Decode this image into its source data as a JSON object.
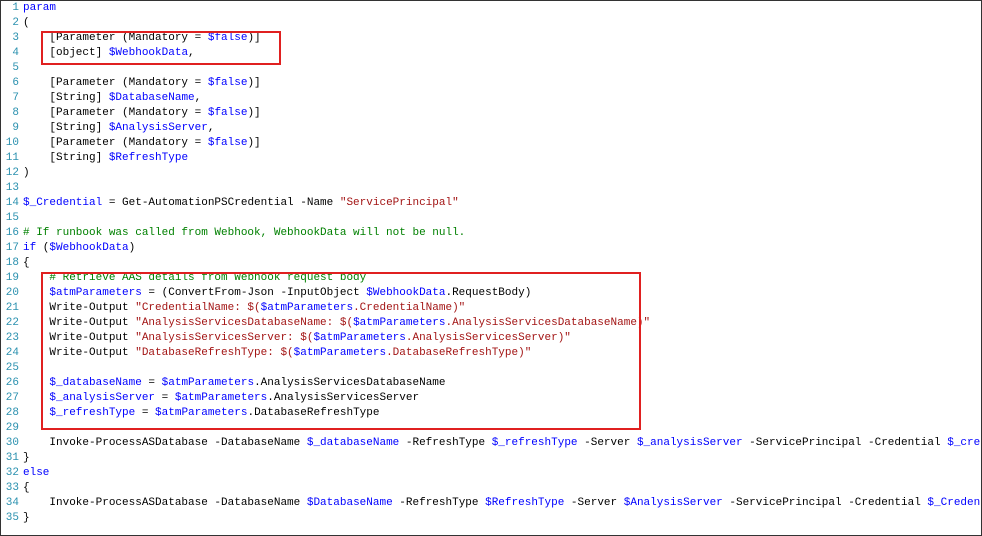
{
  "lines": [
    {
      "n": 1,
      "segs": [
        [
          "kw",
          "param"
        ]
      ]
    },
    {
      "n": 2,
      "segs": [
        [
          "plain",
          "("
        ]
      ]
    },
    {
      "n": 3,
      "segs": [
        [
          "plain",
          "    [Parameter (Mandatory = "
        ],
        [
          "var",
          "$false"
        ],
        [
          "plain",
          ")]"
        ]
      ]
    },
    {
      "n": 4,
      "segs": [
        [
          "plain",
          "    [object] "
        ],
        [
          "var",
          "$WebhookData"
        ],
        [
          "plain",
          ","
        ]
      ]
    },
    {
      "n": 5,
      "segs": []
    },
    {
      "n": 6,
      "segs": [
        [
          "plain",
          "    [Parameter (Mandatory = "
        ],
        [
          "var",
          "$false"
        ],
        [
          "plain",
          ")]"
        ]
      ]
    },
    {
      "n": 7,
      "segs": [
        [
          "plain",
          "    [String] "
        ],
        [
          "var",
          "$DatabaseName"
        ],
        [
          "plain",
          ","
        ]
      ]
    },
    {
      "n": 8,
      "segs": [
        [
          "plain",
          "    [Parameter (Mandatory = "
        ],
        [
          "var",
          "$false"
        ],
        [
          "plain",
          ")]"
        ]
      ]
    },
    {
      "n": 9,
      "segs": [
        [
          "plain",
          "    [String] "
        ],
        [
          "var",
          "$AnalysisServer"
        ],
        [
          "plain",
          ","
        ]
      ]
    },
    {
      "n": 10,
      "segs": [
        [
          "plain",
          "    [Parameter (Mandatory = "
        ],
        [
          "var",
          "$false"
        ],
        [
          "plain",
          ")]"
        ]
      ]
    },
    {
      "n": 11,
      "segs": [
        [
          "plain",
          "    [String] "
        ],
        [
          "var",
          "$RefreshType"
        ]
      ]
    },
    {
      "n": 12,
      "segs": [
        [
          "plain",
          ")"
        ]
      ]
    },
    {
      "n": 13,
      "segs": []
    },
    {
      "n": 14,
      "segs": [
        [
          "var",
          "$_Credential"
        ],
        [
          "plain",
          " = Get-AutomationPSCredential -Name "
        ],
        [
          "str",
          "\"ServicePrincipal\""
        ]
      ]
    },
    {
      "n": 15,
      "segs": []
    },
    {
      "n": 16,
      "segs": [
        [
          "cmt",
          "# If runbook was called from Webhook, WebhookData will not be null."
        ]
      ]
    },
    {
      "n": 17,
      "segs": [
        [
          "kw",
          "if"
        ],
        [
          "plain",
          " ("
        ],
        [
          "var",
          "$WebhookData"
        ],
        [
          "plain",
          ")"
        ]
      ]
    },
    {
      "n": 18,
      "segs": [
        [
          "plain",
          "{"
        ]
      ]
    },
    {
      "n": 19,
      "segs": [
        [
          "plain",
          "    "
        ],
        [
          "cmt",
          "# Retrieve AAS details from Webhook request body"
        ]
      ]
    },
    {
      "n": 20,
      "segs": [
        [
          "plain",
          "    "
        ],
        [
          "var",
          "$atmParameters"
        ],
        [
          "plain",
          " = (ConvertFrom-Json -InputObject "
        ],
        [
          "var",
          "$WebhookData"
        ],
        [
          "plain",
          ".RequestBody)"
        ]
      ]
    },
    {
      "n": 21,
      "segs": [
        [
          "plain",
          "    Write-Output "
        ],
        [
          "str",
          "\"CredentialName: $("
        ],
        [
          "var",
          "$atmParameters"
        ],
        [
          "str",
          ".CredentialName)\""
        ]
      ]
    },
    {
      "n": 22,
      "segs": [
        [
          "plain",
          "    Write-Output "
        ],
        [
          "str",
          "\"AnalysisServicesDatabaseName: $("
        ],
        [
          "var",
          "$atmParameters"
        ],
        [
          "str",
          ".AnalysisServicesDatabaseName)\""
        ]
      ]
    },
    {
      "n": 23,
      "segs": [
        [
          "plain",
          "    Write-Output "
        ],
        [
          "str",
          "\"AnalysisServicesServer: $("
        ],
        [
          "var",
          "$atmParameters"
        ],
        [
          "str",
          ".AnalysisServicesServer)\""
        ]
      ]
    },
    {
      "n": 24,
      "segs": [
        [
          "plain",
          "    Write-Output "
        ],
        [
          "str",
          "\"DatabaseRefreshType: $("
        ],
        [
          "var",
          "$atmParameters"
        ],
        [
          "str",
          ".DatabaseRefreshType)\""
        ]
      ]
    },
    {
      "n": 25,
      "segs": []
    },
    {
      "n": 26,
      "segs": [
        [
          "plain",
          "    "
        ],
        [
          "var",
          "$_databaseName"
        ],
        [
          "plain",
          " = "
        ],
        [
          "var",
          "$atmParameters"
        ],
        [
          "plain",
          ".AnalysisServicesDatabaseName"
        ]
      ]
    },
    {
      "n": 27,
      "segs": [
        [
          "plain",
          "    "
        ],
        [
          "var",
          "$_analysisServer"
        ],
        [
          "plain",
          " = "
        ],
        [
          "var",
          "$atmParameters"
        ],
        [
          "plain",
          ".AnalysisServicesServer"
        ]
      ]
    },
    {
      "n": 28,
      "segs": [
        [
          "plain",
          "    "
        ],
        [
          "var",
          "$_refreshType"
        ],
        [
          "plain",
          " = "
        ],
        [
          "var",
          "$atmParameters"
        ],
        [
          "plain",
          ".DatabaseRefreshType"
        ]
      ]
    },
    {
      "n": 29,
      "segs": []
    },
    {
      "n": 30,
      "segs": [
        [
          "plain",
          "    Invoke-ProcessASDatabase -DatabaseName "
        ],
        [
          "var",
          "$_databaseName"
        ],
        [
          "plain",
          " -RefreshType "
        ],
        [
          "var",
          "$_refreshType"
        ],
        [
          "plain",
          " -Server "
        ],
        [
          "var",
          "$_analysisServer"
        ],
        [
          "plain",
          " -ServicePrincipal -Credential "
        ],
        [
          "var",
          "$_credential"
        ]
      ]
    },
    {
      "n": 31,
      "segs": [
        [
          "plain",
          "}"
        ]
      ]
    },
    {
      "n": 32,
      "segs": [
        [
          "kw",
          "else"
        ]
      ]
    },
    {
      "n": 33,
      "segs": [
        [
          "plain",
          "{"
        ]
      ]
    },
    {
      "n": 34,
      "segs": [
        [
          "plain",
          "    Invoke-ProcessASDatabase -DatabaseName "
        ],
        [
          "var",
          "$DatabaseName"
        ],
        [
          "plain",
          " -RefreshType "
        ],
        [
          "var",
          "$RefreshType"
        ],
        [
          "plain",
          " -Server "
        ],
        [
          "var",
          "$AnalysisServer"
        ],
        [
          "plain",
          " -ServicePrincipal -Credential "
        ],
        [
          "var",
          "$_Credential"
        ]
      ]
    },
    {
      "n": 35,
      "segs": [
        [
          "plain",
          "}"
        ]
      ]
    }
  ]
}
